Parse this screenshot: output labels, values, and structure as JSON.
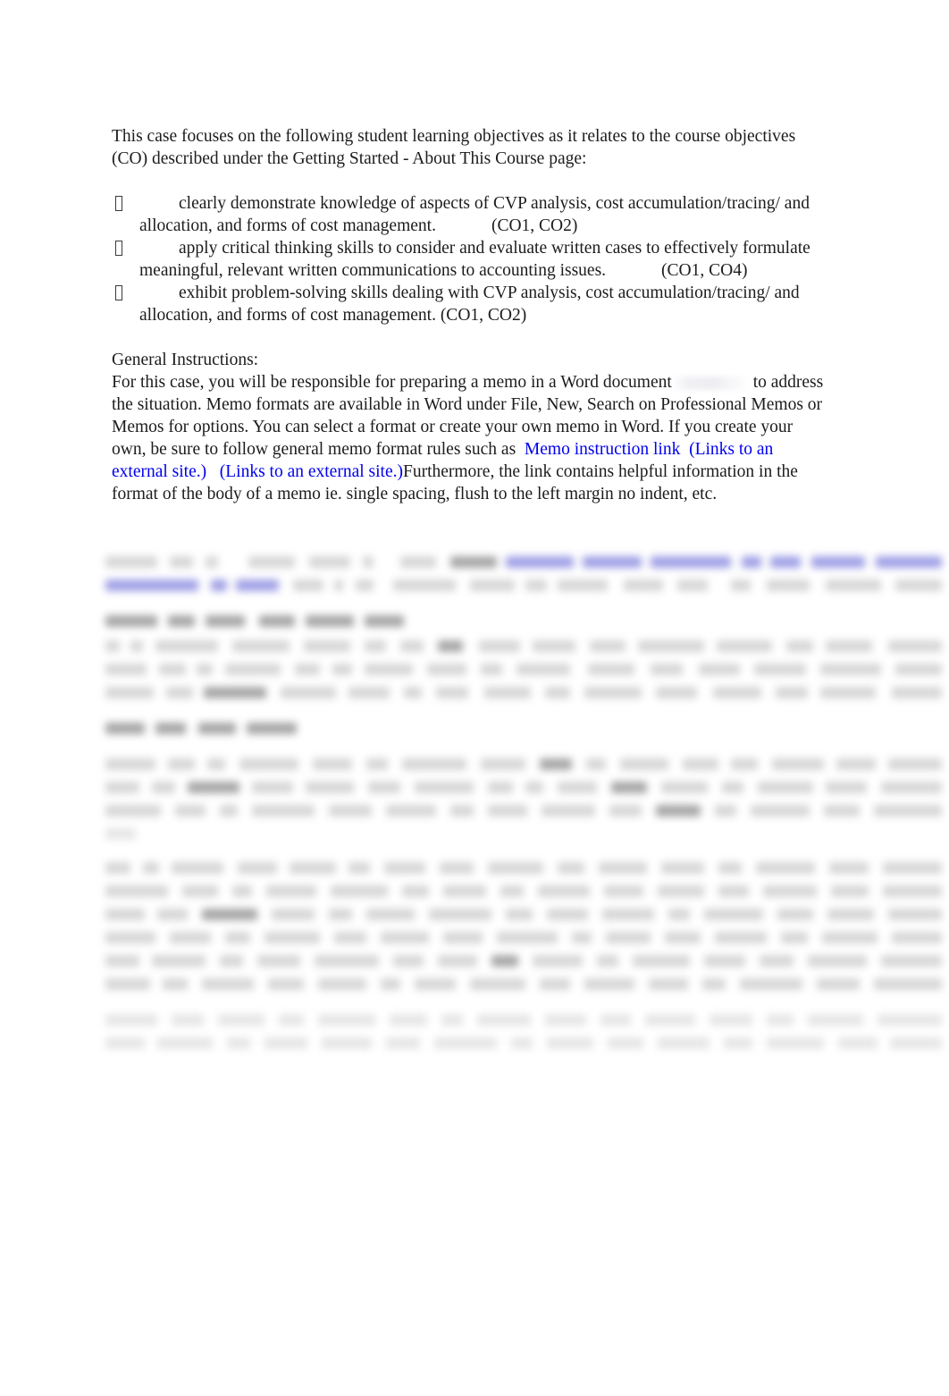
{
  "document": {
    "intro": {
      "line1": "This case focuses on the following student learning objectives as it relates to the course",
      "line2": "objectives (CO) described under the Getting Started - About This Course page:"
    },
    "objectives": [
      {
        "marker": "missing-glyph-box",
        "text_part1": "clearly demonstrate knowledge of aspects of CVP analysis, cost accumulation/tracing/ and allocation, and forms of cost management.",
        "code": "(CO1, CO2)"
      },
      {
        "marker": "missing-glyph-box",
        "text_part1": "apply critical thinking skills to consider and evaluate written cases to effectively formulate meaningful, relevant written communications to accounting issues.",
        "code": "(CO1, CO4)"
      },
      {
        "marker": "missing-glyph-box",
        "text_part1": "exhibit problem-solving skills dealing with CVP analysis, cost accumulation/tracing/ and allocation, and forms of cost management. (CO1, CO2)",
        "code": ""
      }
    ],
    "instructions": {
      "heading": "General Instructions:",
      "body_before_redaction": "For this case, you will be responsible for preparing a memo in a Word document",
      "body_after_redaction": "to address the situation. Memo formats are available in Word under File, New, Search on Professional Memos or Memos for options. You can select a format or create your own memo in Word. If you create your own, be sure to follow general memo format rules such as",
      "link_label": "Memo instruction link",
      "link_note_1": "(Links to an external site.)",
      "link_note_2": "(Links to an external site.)",
      "body_tail": "Furthermore, the link contains helpful information in the format of the body of a memo ie. single spacing, flush to the left margin no indent, etc."
    },
    "redacted_section": {
      "label": "blurred-illegible-content",
      "note": ""
    },
    "colors": {
      "link_blue": "#0000ee",
      "body_text": "#1c1c1c",
      "page_background": "#ffffff"
    }
  }
}
